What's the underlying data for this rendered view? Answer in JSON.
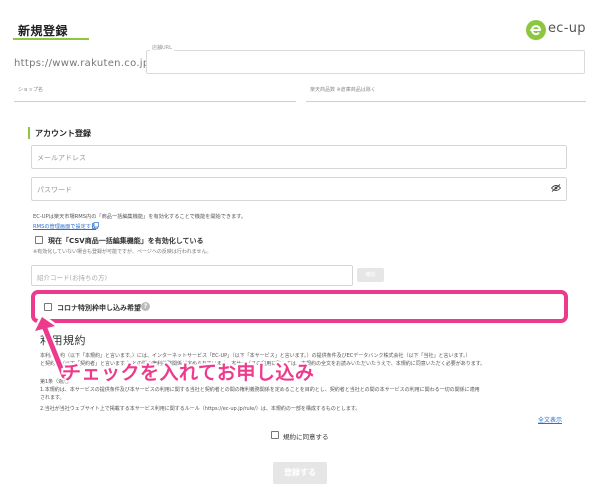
{
  "header": {
    "title": "新規登録",
    "logo_text": "ec-up",
    "accent": "#8dc63f"
  },
  "shop_url": {
    "prefix": "https://www.rakuten.co.jp/",
    "label": "店舗URL",
    "value": ""
  },
  "shop_name": {
    "label": "ショップ名"
  },
  "item_count": {
    "label": "楽天商品数 ※倉庫商品は除く"
  },
  "account": {
    "section_title": "アカウント登録",
    "email_placeholder": "メールアドレス",
    "password_placeholder": "パスワード",
    "info_text": "EC-UPは楽天市場RMS内の「商品一括編集機能」を有効化することで機能を開始できます。",
    "rms_link": "RMSの管理画面で設定する",
    "csv_checkbox_label": "現在「CSV商品一括編集機能」を有効化している",
    "csv_note": "※有効化していない場合も登録が可能ですが、ページへの反映は行われません。",
    "referral_placeholder": "紹介コード(お持ちの方)",
    "confirm_label": "確認",
    "corona_label": "コロナ特別枠申し込み希望",
    "help_glyph": "?"
  },
  "terms": {
    "title": "利用規約",
    "lines": [
      "本利用規約（以下「本規約」と言います。）には、インターネットサービス「EC-UP」（以下「本サービス」と言います。）の提供条件及びECデータバンク株式会社（以下「当社」と言います。）",
      "と契約者（以下「契約者」と言います。）との間の権利義務関係が定められています。本サービスの利用に際しては、本規約の全文をお読みいただいたうえで、本規約に同意いただく必要があります。",
      "第1条（適用）",
      "1.本規約は、本サービスの提供条件及び本サービスの利用に関する当社と契約者との間の権利義務関係を定めることを目的とし、契約者と当社との間の本サービスの利用に関わる一切の関係に適用",
      "されます。",
      "2.当社が当社ウェブサイト上で掲載する本サービス利用に関するルール（https://ec-up.jp/rule/）は、本規約の一部を構成するものとします。"
    ],
    "full_text_link": "全文表示",
    "agree_label": "規約に同意する"
  },
  "annotation": {
    "text": "チェックを入れてお申し込み",
    "color": "#ee3a8c"
  },
  "register_button": "登録する"
}
